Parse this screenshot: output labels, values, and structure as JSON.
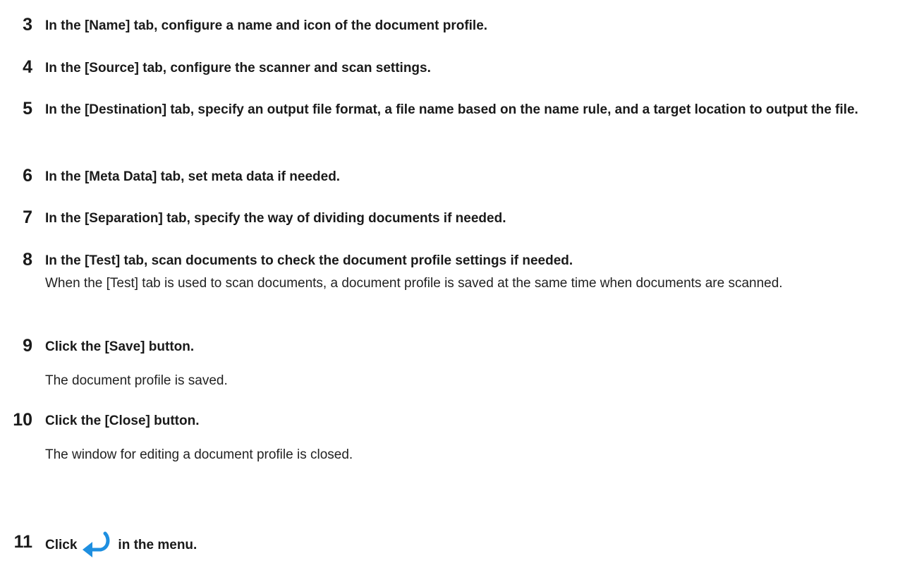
{
  "steps": [
    {
      "number": "3",
      "title": "In the [Name] tab, configure a name and icon of the document profile."
    },
    {
      "number": "4",
      "title": "In the [Source] tab, configure the scanner and scan settings."
    },
    {
      "number": "5",
      "title": "In the [Destination] tab, specify an output file format, a file name based on the name rule, and a target location to output the file."
    },
    {
      "number": "6",
      "title": "In the [Meta Data] tab, set meta data if needed."
    },
    {
      "number": "7",
      "title": "In the [Separation] tab, specify the way of dividing documents if needed."
    },
    {
      "number": "8",
      "title": "In the [Test] tab, scan documents to check the document profile settings if needed.",
      "description": "When the [Test] tab is used to scan documents, a document profile is saved at the same time when documents are scanned."
    },
    {
      "number": "9",
      "title": "Click the [Save] button.",
      "description": "The document profile is saved."
    },
    {
      "number": "10",
      "title": "Click the [Close] button.",
      "description": "The window for editing a document profile is closed."
    },
    {
      "number": "11",
      "title_before_icon": "Click",
      "icon": "return-arrow-icon",
      "title_after_icon": "in the menu."
    }
  ],
  "colors": {
    "icon_blue": "#1e8fe0",
    "text": "#1a1a1a"
  }
}
